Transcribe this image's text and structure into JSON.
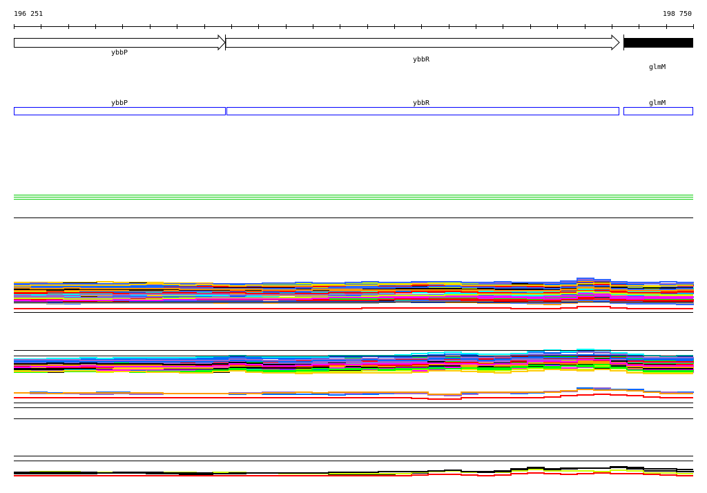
{
  "ruler": {
    "start_label": "196 251",
    "end_label": "198 750"
  },
  "genes": [
    {
      "name": "ybbP",
      "strand": "+",
      "style": "open-arrow"
    },
    {
      "name": "ybbR",
      "strand": "+",
      "style": "open-arrow"
    },
    {
      "name": "glmM",
      "strand": "+",
      "style": "filled"
    }
  ],
  "annotation_track": [
    {
      "name": "ybbP"
    },
    {
      "name": "ybbR"
    },
    {
      "name": "glmM"
    }
  ],
  "colors": {
    "annotation": "#0000ff",
    "reference": "#00cc00",
    "palette": [
      "#ff0000",
      "#ff00ff",
      "#00ff00",
      "#00ffff",
      "#0066ff",
      "#ff9900",
      "#999999",
      "#ccff00",
      "#000000",
      "#9966cc",
      "#3366ff",
      "#ffcc00"
    ]
  }
}
